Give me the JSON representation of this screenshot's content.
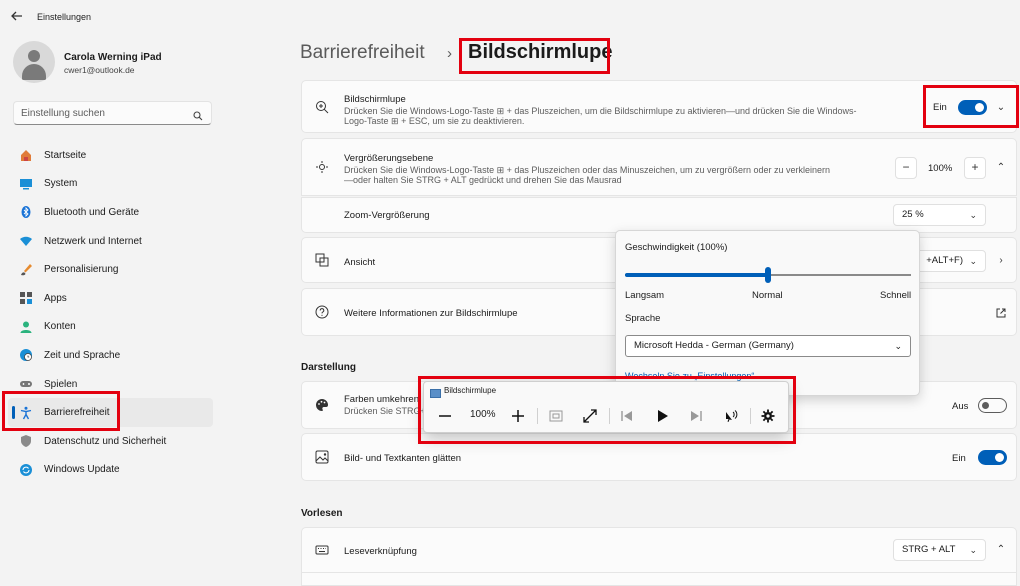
{
  "app": {
    "title": "Einstellungen"
  },
  "profile": {
    "name": "Carola Werning iPad",
    "email": "cwer1@outlook.de"
  },
  "search": {
    "placeholder": "Einstellung suchen"
  },
  "nav": {
    "items": [
      {
        "label": "Startseite",
        "icon": "home-icon"
      },
      {
        "label": "System",
        "icon": "system-icon"
      },
      {
        "label": "Bluetooth und Geräte",
        "icon": "bluetooth-icon"
      },
      {
        "label": "Netzwerk und Internet",
        "icon": "wifi-icon"
      },
      {
        "label": "Personalisierung",
        "icon": "brush-icon"
      },
      {
        "label": "Apps",
        "icon": "apps-icon"
      },
      {
        "label": "Konten",
        "icon": "account-icon"
      },
      {
        "label": "Zeit und Sprache",
        "icon": "globe-clock-icon"
      },
      {
        "label": "Spielen",
        "icon": "gamepad-icon"
      },
      {
        "label": "Barrierefreiheit",
        "icon": "accessibility-icon"
      },
      {
        "label": "Datenschutz und Sicherheit",
        "icon": "shield-icon"
      },
      {
        "label": "Windows Update",
        "icon": "update-icon"
      }
    ],
    "active_index": 9
  },
  "breadcrumb": {
    "parent": "Barrierefreiheit",
    "separator": "›",
    "current": "Bildschirmlupe"
  },
  "magnifier_card": {
    "title": "Bildschirmlupe",
    "desc_line1": "Drücken Sie die Windows-Logo-Taste ⊞ + das Pluszeichen, um die Bildschirmlupe zu aktivieren—und drücken Sie die Windows-",
    "desc_line2": "Logo-Taste ⊞ + ESC, um sie zu deaktivieren.",
    "state": "Ein"
  },
  "zoom_level_card": {
    "title": "Vergrößerungsebene",
    "desc_line1": "Drücken Sie die Windows-Logo-Taste ⊞ + das Pluszeichen oder das Minuszeichen, um zu vergrößern oder zu verkleinern",
    "desc_line2": "—oder halten Sie STRG + ALT gedrückt und drehen Sie das Mausrad",
    "value": "100%",
    "minus": "−",
    "plus": "+"
  },
  "zoom_increment": {
    "label": "Zoom-Vergrößerung",
    "value": "25 %"
  },
  "view_card": {
    "title": "Ansicht",
    "shortcut": "+ALT+F)"
  },
  "more_info": {
    "title": "Weitere Informationen zur Bildschirmlupe"
  },
  "section_display": "Darstellung",
  "invert_card": {
    "title": "Farben umkehren",
    "desc": "Drücken Sie STRG+A",
    "state": "Aus"
  },
  "smooth_card": {
    "title": "Bild- und Textkanten glätten",
    "state": "Ein"
  },
  "section_read": "Vorlesen",
  "read_shortcut": {
    "title": "Leseverknüpfung",
    "value": "STRG + ALT"
  },
  "speed_popup": {
    "title": "Geschwindigkeit (100%)",
    "slider_fraction": 0.5,
    "slow": "Langsam",
    "normal": "Normal",
    "fast": "Schnell",
    "lang_title": "Sprache",
    "voice": "Microsoft Hedda - German (Germany)",
    "link": "Wechseln Sie zu „Einstellungen“"
  },
  "magnifier_toolbar": {
    "title": "Bildschirmlupe",
    "zoom": "100%"
  },
  "colors": {
    "accent": "#005fb8",
    "highlight": "#e3000f"
  }
}
